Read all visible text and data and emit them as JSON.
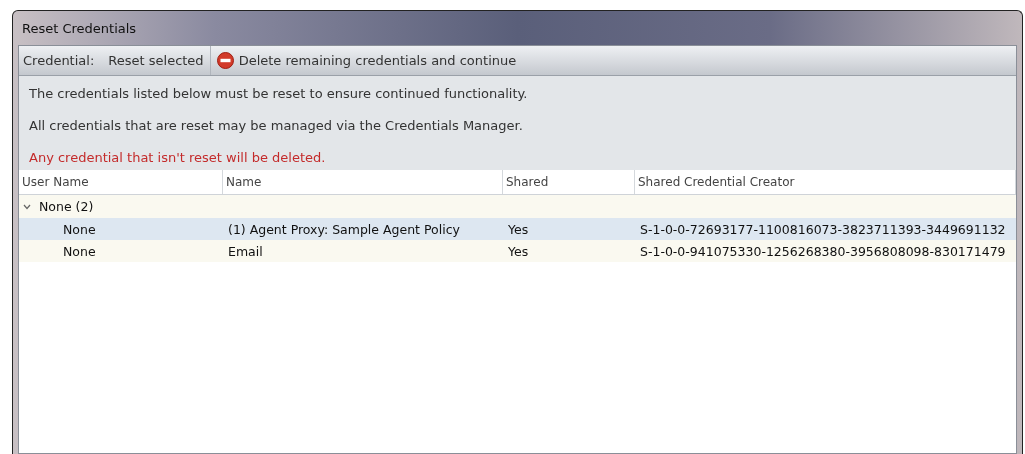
{
  "window": {
    "title": "Reset Credentials"
  },
  "toolbar": {
    "label": "Credential:",
    "buttons": [
      {
        "label": "Reset selected",
        "kind": "plain"
      },
      {
        "label": "Delete remaining credentials and continue",
        "kind": "delete"
      }
    ]
  },
  "messages": [
    {
      "text": "The credentials listed below must be reset to ensure continued functionality.",
      "kind": "info"
    },
    {
      "text": "All credentials that are reset may be managed via the Credentials Manager.",
      "kind": "info"
    },
    {
      "text": "Any credential that isn't reset will be deleted.",
      "kind": "warning"
    }
  ],
  "table": {
    "columns": [
      "User Name",
      "Name",
      "Shared",
      "Shared Credential Creator"
    ],
    "groups": [
      {
        "label": "None (2)",
        "expanded": true,
        "rows": [
          {
            "cells": [
              "None",
              "(1) Agent Proxy: Sample Agent Policy",
              "Yes",
              "S-1-0-0-72693177-1100816073-3823711393-3449691132"
            ],
            "selected": true
          },
          {
            "cells": [
              "None",
              "Email",
              "Yes",
              "S-1-0-0-941075330-1256268380-3956808098-830171479"
            ],
            "selected": false
          }
        ]
      }
    ]
  }
}
